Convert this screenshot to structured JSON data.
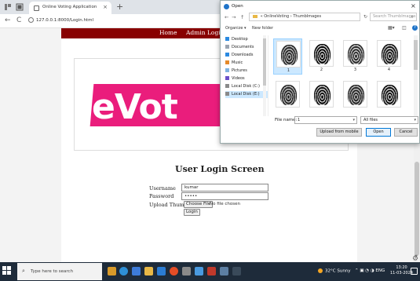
{
  "browser": {
    "tab_title": "Online Voting Application",
    "tab_close": "×",
    "new_tab": "+",
    "back": "←",
    "reload": "C",
    "url": "127.0.0.1:8000/Login.html"
  },
  "page": {
    "nav": {
      "home": "Home",
      "admin_login": "Admin Login"
    },
    "banner_text": "eVot",
    "login_title": "User Login Screen",
    "form": {
      "username_label": "Username",
      "username_value": "kumar",
      "password_label": "Password",
      "password_value": "•••••",
      "upload_label": "Upload Thumb",
      "choose_file_label": "Choose File",
      "no_file_text": "No file chosen",
      "login_label": "Login"
    }
  },
  "dialog": {
    "title": "Open",
    "close": "×",
    "path": {
      "segments": [
        "«",
        "OnlineVoting",
        "›",
        "ThumbImages"
      ],
      "separator": " "
    },
    "search_placeholder": "Search ThumbImages",
    "toolbar": {
      "organize": "Organize ▾",
      "new_folder": "New folder"
    },
    "sidebar": [
      {
        "label": "Desktop",
        "color": "#2b8ae0"
      },
      {
        "label": "Documents",
        "color": "#9aa4b0"
      },
      {
        "label": "Downloads",
        "color": "#2b8ae0"
      },
      {
        "label": "Music",
        "color": "#e58a2a"
      },
      {
        "label": "Pictures",
        "color": "#7fb4e0"
      },
      {
        "label": "Videos",
        "color": "#6a4fc9"
      },
      {
        "label": "Local Disk (C:)",
        "color": "#8a8a8a"
      },
      {
        "label": "Local Disk (E:)",
        "color": "#8a8a8a"
      }
    ],
    "thumbnails": [
      "1",
      "2",
      "3",
      "4",
      "",
      "",
      "",
      ""
    ],
    "file_name_label": "File name:",
    "file_name_value": "1",
    "file_type": "All files",
    "upload_mobile": "Upload from mobile",
    "open": "Open",
    "cancel": "Cancel"
  },
  "taskbar": {
    "search_placeholder": "Type here to search",
    "weather": "32°C Sunny",
    "tray_lang": "ENG",
    "time": "13:20",
    "date": "11-03-2024"
  }
}
